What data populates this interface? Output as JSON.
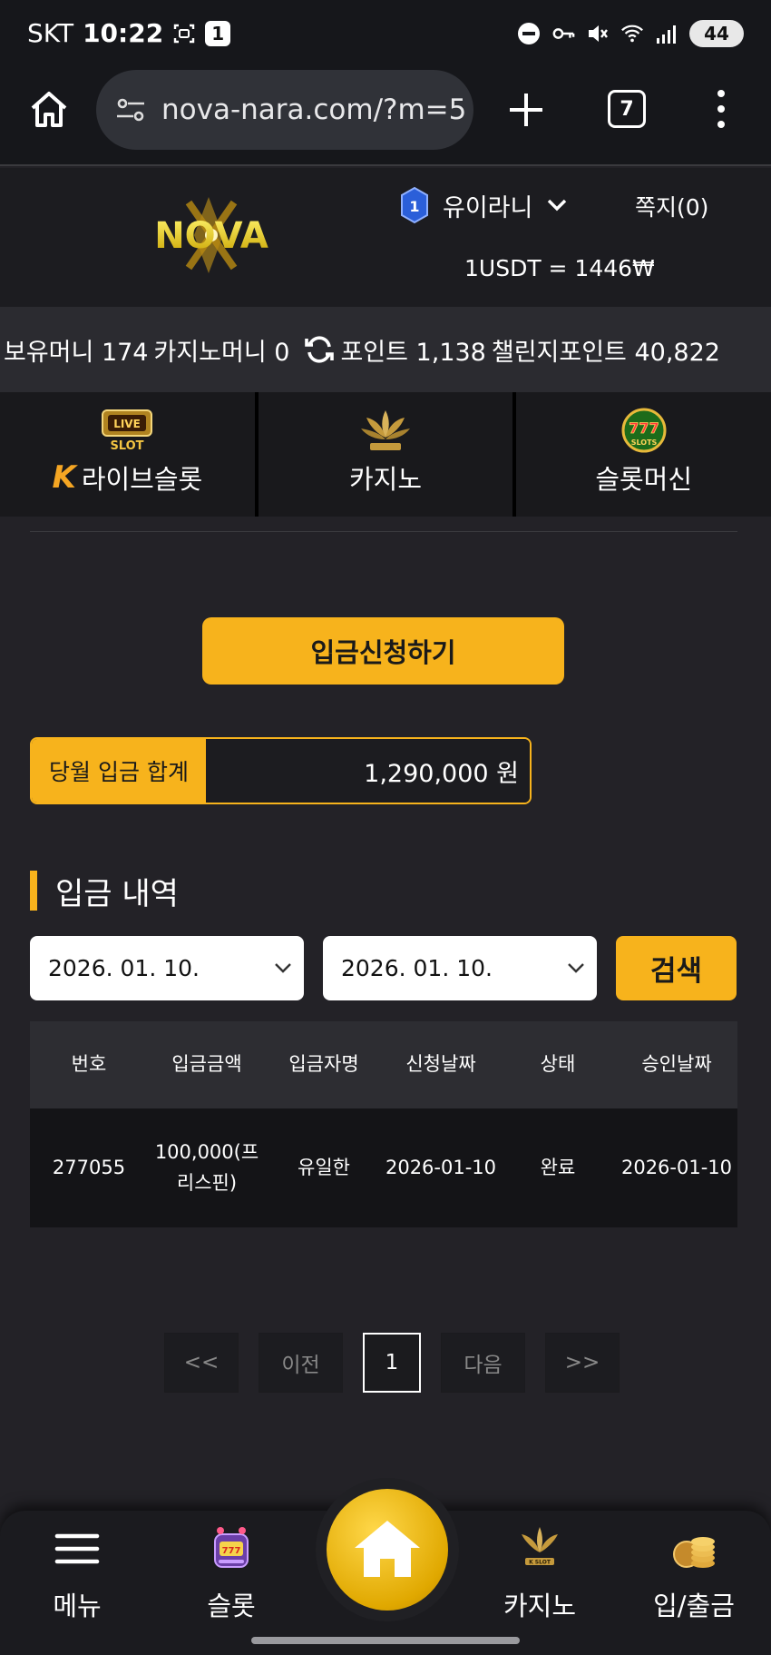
{
  "status_bar": {
    "carrier": "SKT",
    "time": "10:22",
    "notification_count": "1",
    "battery": "44"
  },
  "browser": {
    "url": "nova-nara.com/?m=5",
    "tab_count": "7"
  },
  "header": {
    "logo_text": "NOVA",
    "level": "1",
    "username": "유이라니",
    "messages": "쪽지(0)",
    "exchange_rate": "1USDT = 1446₩"
  },
  "balance": {
    "money": "보유머니 174",
    "casino_money": "카지노머니 0",
    "points": "포인트 1,138",
    "challenge_points": "챌린지포인트 40,822"
  },
  "categories": [
    {
      "label": "라이브슬롯",
      "badge": "K"
    },
    {
      "label": "카지노"
    },
    {
      "label": "슬롯머신"
    }
  ],
  "deposit": {
    "request_button": "입금신청하기",
    "monthly_label": "당월 입금 합계",
    "monthly_value": "1,290,000 원",
    "section_title": "입금 내역",
    "date_from": "2026. 01. 10.",
    "date_to": "2026. 01. 10.",
    "search_button": "검색"
  },
  "table": {
    "headers": [
      "번호",
      "입금금액",
      "입금자명",
      "신청날짜",
      "상태",
      "승인날짜"
    ],
    "rows": [
      [
        "277055",
        "100,000(프리스핀)",
        "유일한",
        "2026-01-10",
        "완료",
        "2026-01-10"
      ]
    ]
  },
  "pagination": {
    "first": "<<",
    "prev": "이전",
    "current": "1",
    "next": "다음",
    "last": ">>"
  },
  "bottom_nav": {
    "menu": "메뉴",
    "slot": "슬롯",
    "casino": "카지노",
    "deposit_withdraw": "입/출금"
  },
  "colors": {
    "accent": "#f7b31c",
    "background": "#232227"
  }
}
